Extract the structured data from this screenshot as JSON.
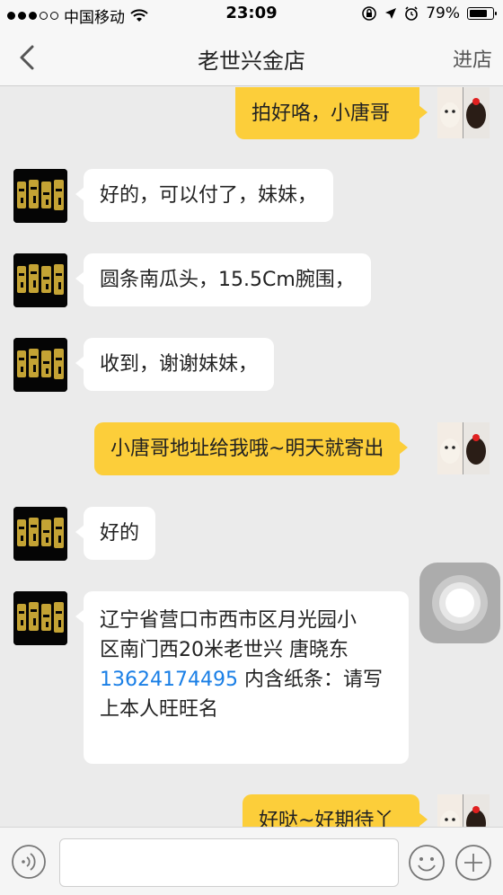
{
  "status_bar": {
    "carrier": "中国移动",
    "time": "23:09",
    "battery": "79%",
    "battery_level": 0.79
  },
  "nav": {
    "title": "老世兴金店",
    "right_action": "进店"
  },
  "messages": [
    {
      "from": "me",
      "text": "拍好咯，小唐哥"
    },
    {
      "from": "shop",
      "text": "好的，可以付了，妹妹，"
    },
    {
      "from": "shop",
      "text": "圆条南瓜头，15.5Cm腕围，"
    },
    {
      "from": "shop",
      "text": "收到，谢谢妹妹，"
    },
    {
      "from": "me",
      "text": "小唐哥地址给我哦~明天就寄出"
    },
    {
      "from": "shop",
      "text": "好的"
    },
    {
      "from": "shop",
      "text_line1": "辽宁省营口市西市区月光园小",
      "text_line2": "区南门西20米老世兴 唐晓东",
      "phone": "13624174495",
      "text_after_phone": " 内含纸条：请写",
      "text_line4": "上本人旺旺名"
    },
    {
      "from": "me",
      "text": "好哒~好期待丫"
    }
  ],
  "input": {
    "value": "",
    "placeholder": ""
  },
  "colors": {
    "outgoing_bubble": "#fcce3a",
    "incoming_bubble": "#ffffff",
    "link": "#1a7fe6",
    "background": "#ebebeb"
  },
  "icons": {
    "back": "chevron-left-icon",
    "voice": "voice-icon",
    "emoji": "emoji-icon",
    "plus": "plus-icon"
  }
}
